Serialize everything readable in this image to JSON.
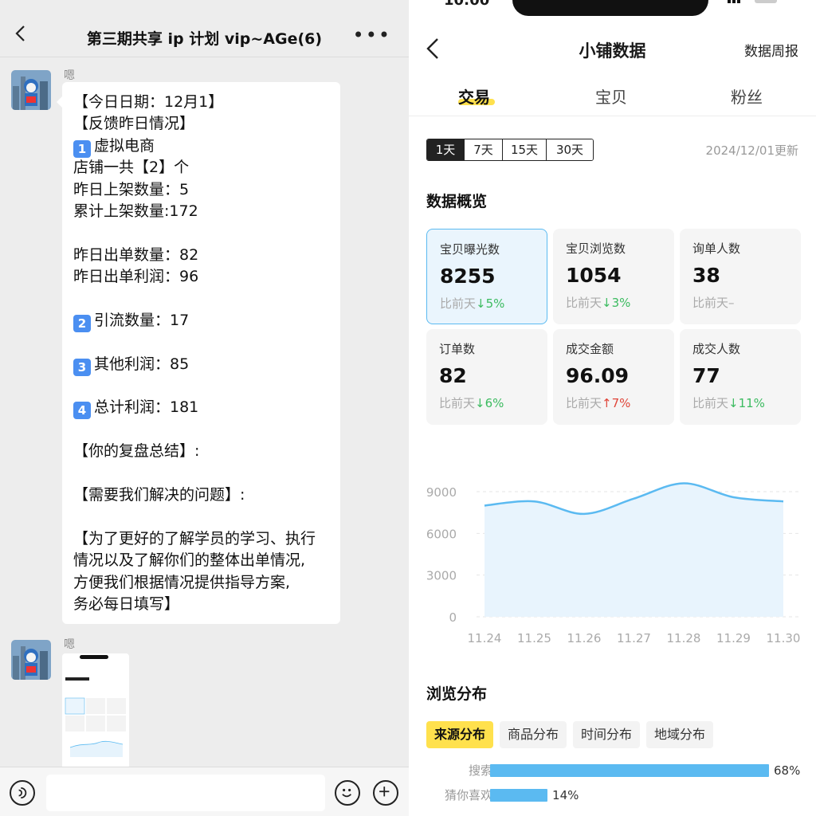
{
  "chat": {
    "title": "第三期共享 ip 计划 vip~AGe(6)",
    "sender": "嗯",
    "message_lines": [
      {
        "text": "【今日日期：12月1】"
      },
      {
        "text": "【反馈昨日情况】"
      },
      {
        "num": "1",
        "text": "虚拟电商"
      },
      {
        "text": "店铺一共【2】个"
      },
      {
        "text": "昨日上架数量：5"
      },
      {
        "text": "累计上架数量:172"
      },
      {
        "text": ""
      },
      {
        "text": "昨日出单数量：82"
      },
      {
        "text": "昨日出单利润：96"
      },
      {
        "text": ""
      },
      {
        "num": "2",
        "text": "引流数量：17"
      },
      {
        "text": ""
      },
      {
        "num": "3",
        "text": "其他利润：85"
      },
      {
        "text": ""
      },
      {
        "num": "4",
        "text": "总计利润：181"
      },
      {
        "text": ""
      },
      {
        "text": "【你的复盘总结】:"
      },
      {
        "text": ""
      },
      {
        "text": "【需要我们解决的问题】:"
      },
      {
        "text": ""
      },
      {
        "text": "【为了更好的了解学员的学习、执行"
      },
      {
        "text": "情况以及了解你们的整体出单情况,"
      },
      {
        "text": "方便我们根据情况提供指导方案,"
      },
      {
        "text": "务必每日填写】"
      }
    ]
  },
  "app": {
    "status_time": "10:00",
    "title": "小铺数据",
    "weekly_report": "数据周报",
    "tabs": [
      "交易",
      "宝贝",
      "粉丝"
    ],
    "active_tab": 0,
    "ranges": [
      "1天",
      "7天",
      "15天",
      "30天"
    ],
    "active_range": 0,
    "update_time": "2024/12/01更新",
    "overview_title": "数据概览",
    "compare_prefix": "比前天",
    "metrics": [
      {
        "label": "宝贝曝光数",
        "value": "8255",
        "dir": "down",
        "change": "5%"
      },
      {
        "label": "宝贝浏览数",
        "value": "1054",
        "dir": "down",
        "change": "3%"
      },
      {
        "label": "询单人数",
        "value": "38",
        "dir": "none",
        "change": "–"
      },
      {
        "label": "订单数",
        "value": "82",
        "dir": "down",
        "change": "6%"
      },
      {
        "label": "成交金额",
        "value": "96.09",
        "dir": "up",
        "change": "7%"
      },
      {
        "label": "成交人数",
        "value": "77",
        "dir": "down",
        "change": "11%"
      }
    ],
    "dist_title": "浏览分布",
    "dist_tabs": [
      "来源分布",
      "商品分布",
      "时间分布",
      "地域分布"
    ],
    "active_dist_tab": 0,
    "dist_bars": [
      {
        "label": "搜索",
        "pct": "68%",
        "value": 68
      },
      {
        "label": "猜你喜欢",
        "pct": "14%",
        "value": 14
      }
    ],
    "colors": {
      "accent": "#ffe14d",
      "chart": "#5bbaf1",
      "down": "#3cbb60",
      "up": "#e0463a"
    }
  },
  "chart_data": {
    "type": "area",
    "x": [
      "11.24",
      "11.25",
      "11.26",
      "11.27",
      "11.28",
      "11.29",
      "11.30"
    ],
    "values": [
      8000,
      8300,
      7400,
      8500,
      9600,
      8600,
      8300
    ],
    "yticks": [
      0,
      3000,
      6000,
      9000
    ],
    "ylim": [
      0,
      9000
    ],
    "grid": true
  }
}
